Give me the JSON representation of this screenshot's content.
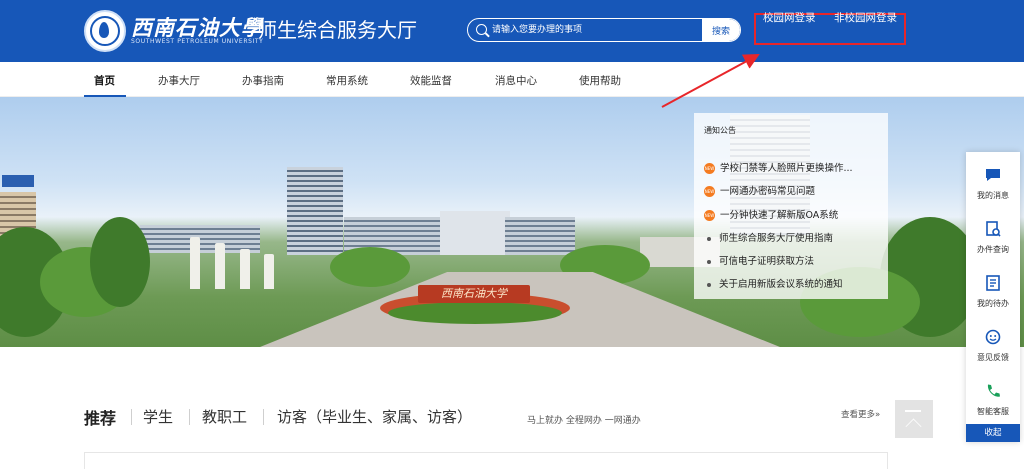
{
  "header": {
    "logo_cn": "西南石油大學",
    "logo_en": "SOUTHWEST PETROLEUM UNIVERSITY",
    "site_title": "师生综合服务大厅",
    "search_placeholder": "请输入您要办理的事项",
    "search_button": "搜索",
    "login_campus": "校园网登录",
    "login_noncampus": "非校园网登录",
    "brand_color": "#1757b8",
    "highlight_color": "#e8262a"
  },
  "nav": {
    "items": [
      "首页",
      "办事大厅",
      "办事指南",
      "常用系统",
      "效能监督",
      "消息中心",
      "使用帮助"
    ],
    "active": "首页"
  },
  "banner": {
    "sign_text": "西南石油大学"
  },
  "notice": {
    "title": "通知公告",
    "new_badge": "NEW",
    "items": [
      "学校门禁等人脸照片更换操作...",
      "一网通办密码常见问题",
      "一分钟快速了解新版OA系统",
      "师生综合服务大厅使用指南",
      "可信电子证明获取方法",
      "关于启用新版会议系统的通知"
    ]
  },
  "sidebar": {
    "items": [
      "我的消息",
      "办件查询",
      "我的待办",
      "意见反馈",
      "智能客服"
    ],
    "collapse": "收起"
  },
  "recommend": {
    "title": "推荐",
    "tabs": [
      "学生",
      "教职工",
      "访客（毕业生、家属、访客）"
    ],
    "slogan": "马上就办 全程网办 一网通办",
    "more": "查看更多»"
  }
}
